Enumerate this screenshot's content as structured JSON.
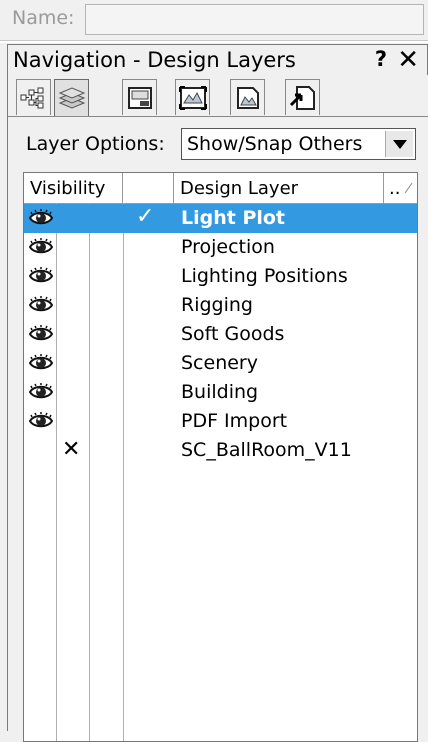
{
  "name_field": {
    "label": "Name:",
    "value": ""
  },
  "palette": {
    "title": "Navigation - Design Layers",
    "help": "?",
    "close": "✕"
  },
  "tabs": [
    {
      "icon": "class-hierarchy-icon",
      "active": false
    },
    {
      "icon": "design-layers-icon",
      "active": true
    },
    {
      "icon": "sheet-layers-icon",
      "active": false
    },
    {
      "icon": "viewports-icon",
      "active": false
    },
    {
      "icon": "saved-views-icon",
      "active": false
    },
    {
      "icon": "referenced-files-icon",
      "active": false
    }
  ],
  "layer_options": {
    "label": "Layer Options:",
    "value": "Show/Snap Others"
  },
  "columns": {
    "visibility": "Visibility",
    "active": "",
    "name": "Design Layer",
    "more": ".."
  },
  "layers": [
    {
      "name": "Light Plot",
      "visibility": "visible",
      "active": true
    },
    {
      "name": "Projection",
      "visibility": "visible",
      "active": false
    },
    {
      "name": "Lighting Positions",
      "visibility": "visible",
      "active": false
    },
    {
      "name": "Rigging",
      "visibility": "visible",
      "active": false
    },
    {
      "name": "Soft Goods",
      "visibility": "visible",
      "active": false
    },
    {
      "name": "Scenery",
      "visibility": "visible",
      "active": false
    },
    {
      "name": "Building",
      "visibility": "visible",
      "active": false
    },
    {
      "name": "PDF Import",
      "visibility": "visible",
      "active": false
    },
    {
      "name": "SC_BallRoom_V11",
      "visibility": "hidden",
      "active": false
    }
  ],
  "colors": {
    "selection": "#3399e0",
    "panel_bg": "#f0f0f0"
  }
}
